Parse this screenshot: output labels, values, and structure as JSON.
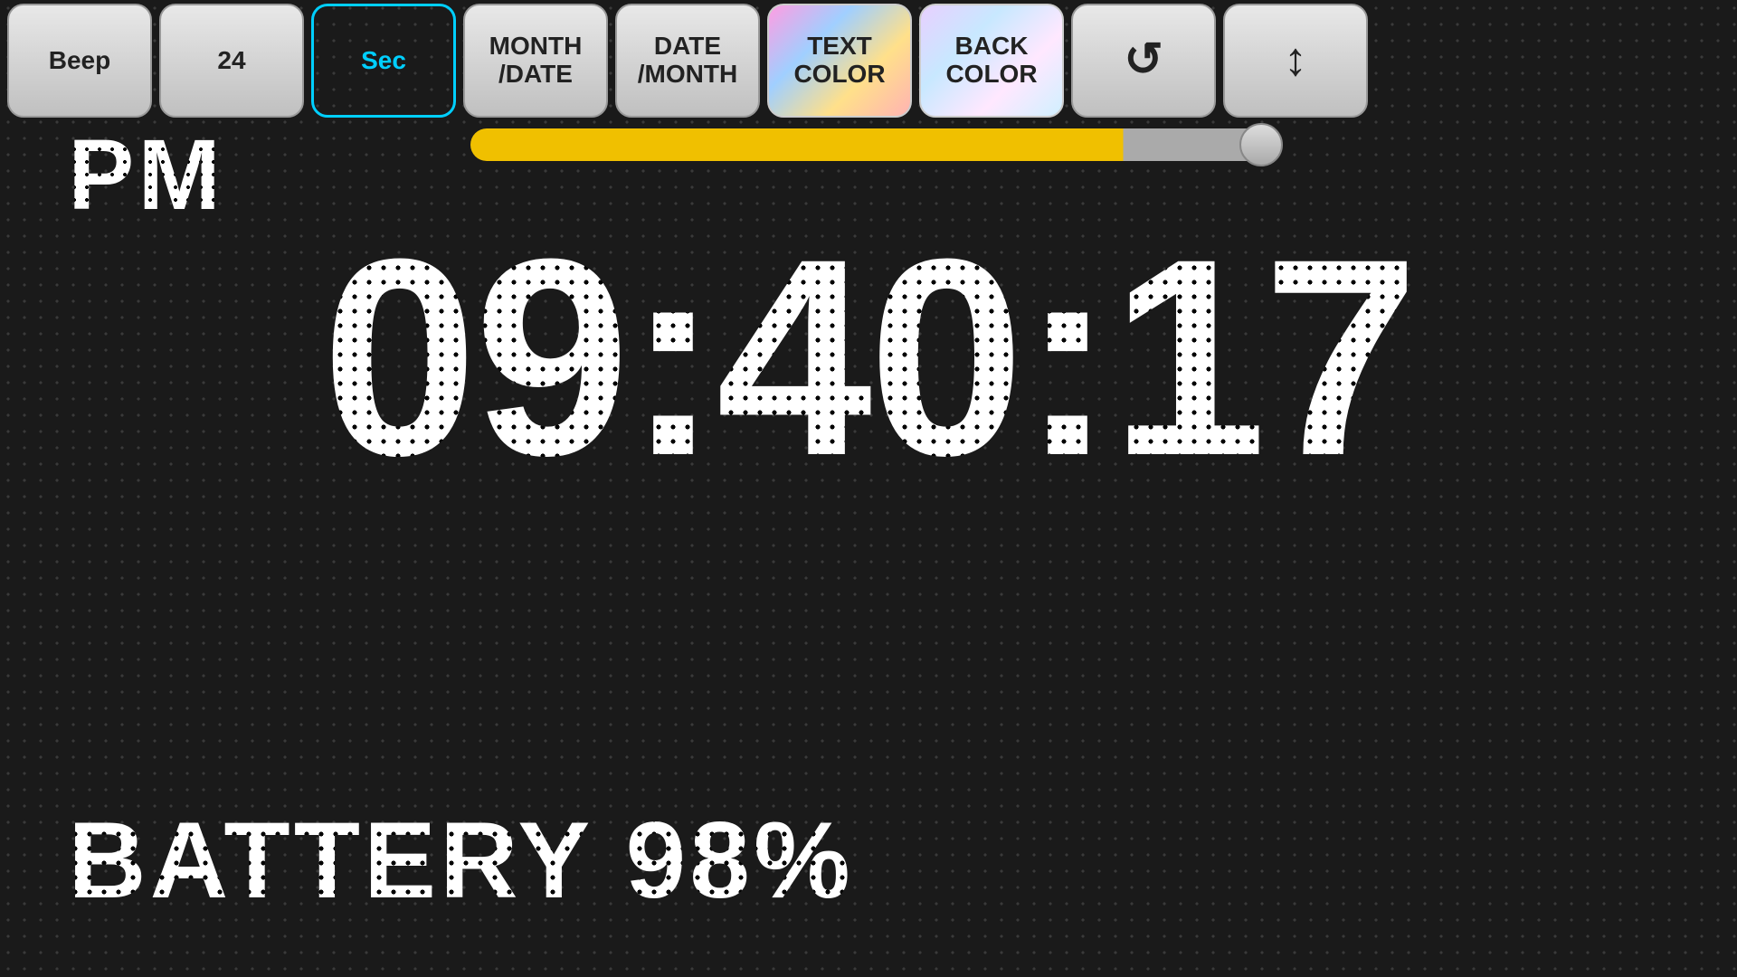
{
  "toolbar": {
    "beep_label": "Beep",
    "hour_label": "24",
    "sec_label": "Sec",
    "month_date_label": "MONTH\n/DATE",
    "date_month_label": "DATE\n/MONTH",
    "text_color_label": "TEXT\nCOLOR",
    "back_color_label": "BACK\nCOLOR",
    "rotate_icon": "↺",
    "flip_icon": "↕"
  },
  "slider": {
    "value": 82,
    "max": 100
  },
  "clock": {
    "period": "PM",
    "time": "09:40:17"
  },
  "battery": {
    "label": "BATTERY 98%"
  },
  "colors": {
    "accent_cyan": "#00cfff",
    "slider_fill": "#f0c000",
    "background": "#1a1a1a"
  }
}
